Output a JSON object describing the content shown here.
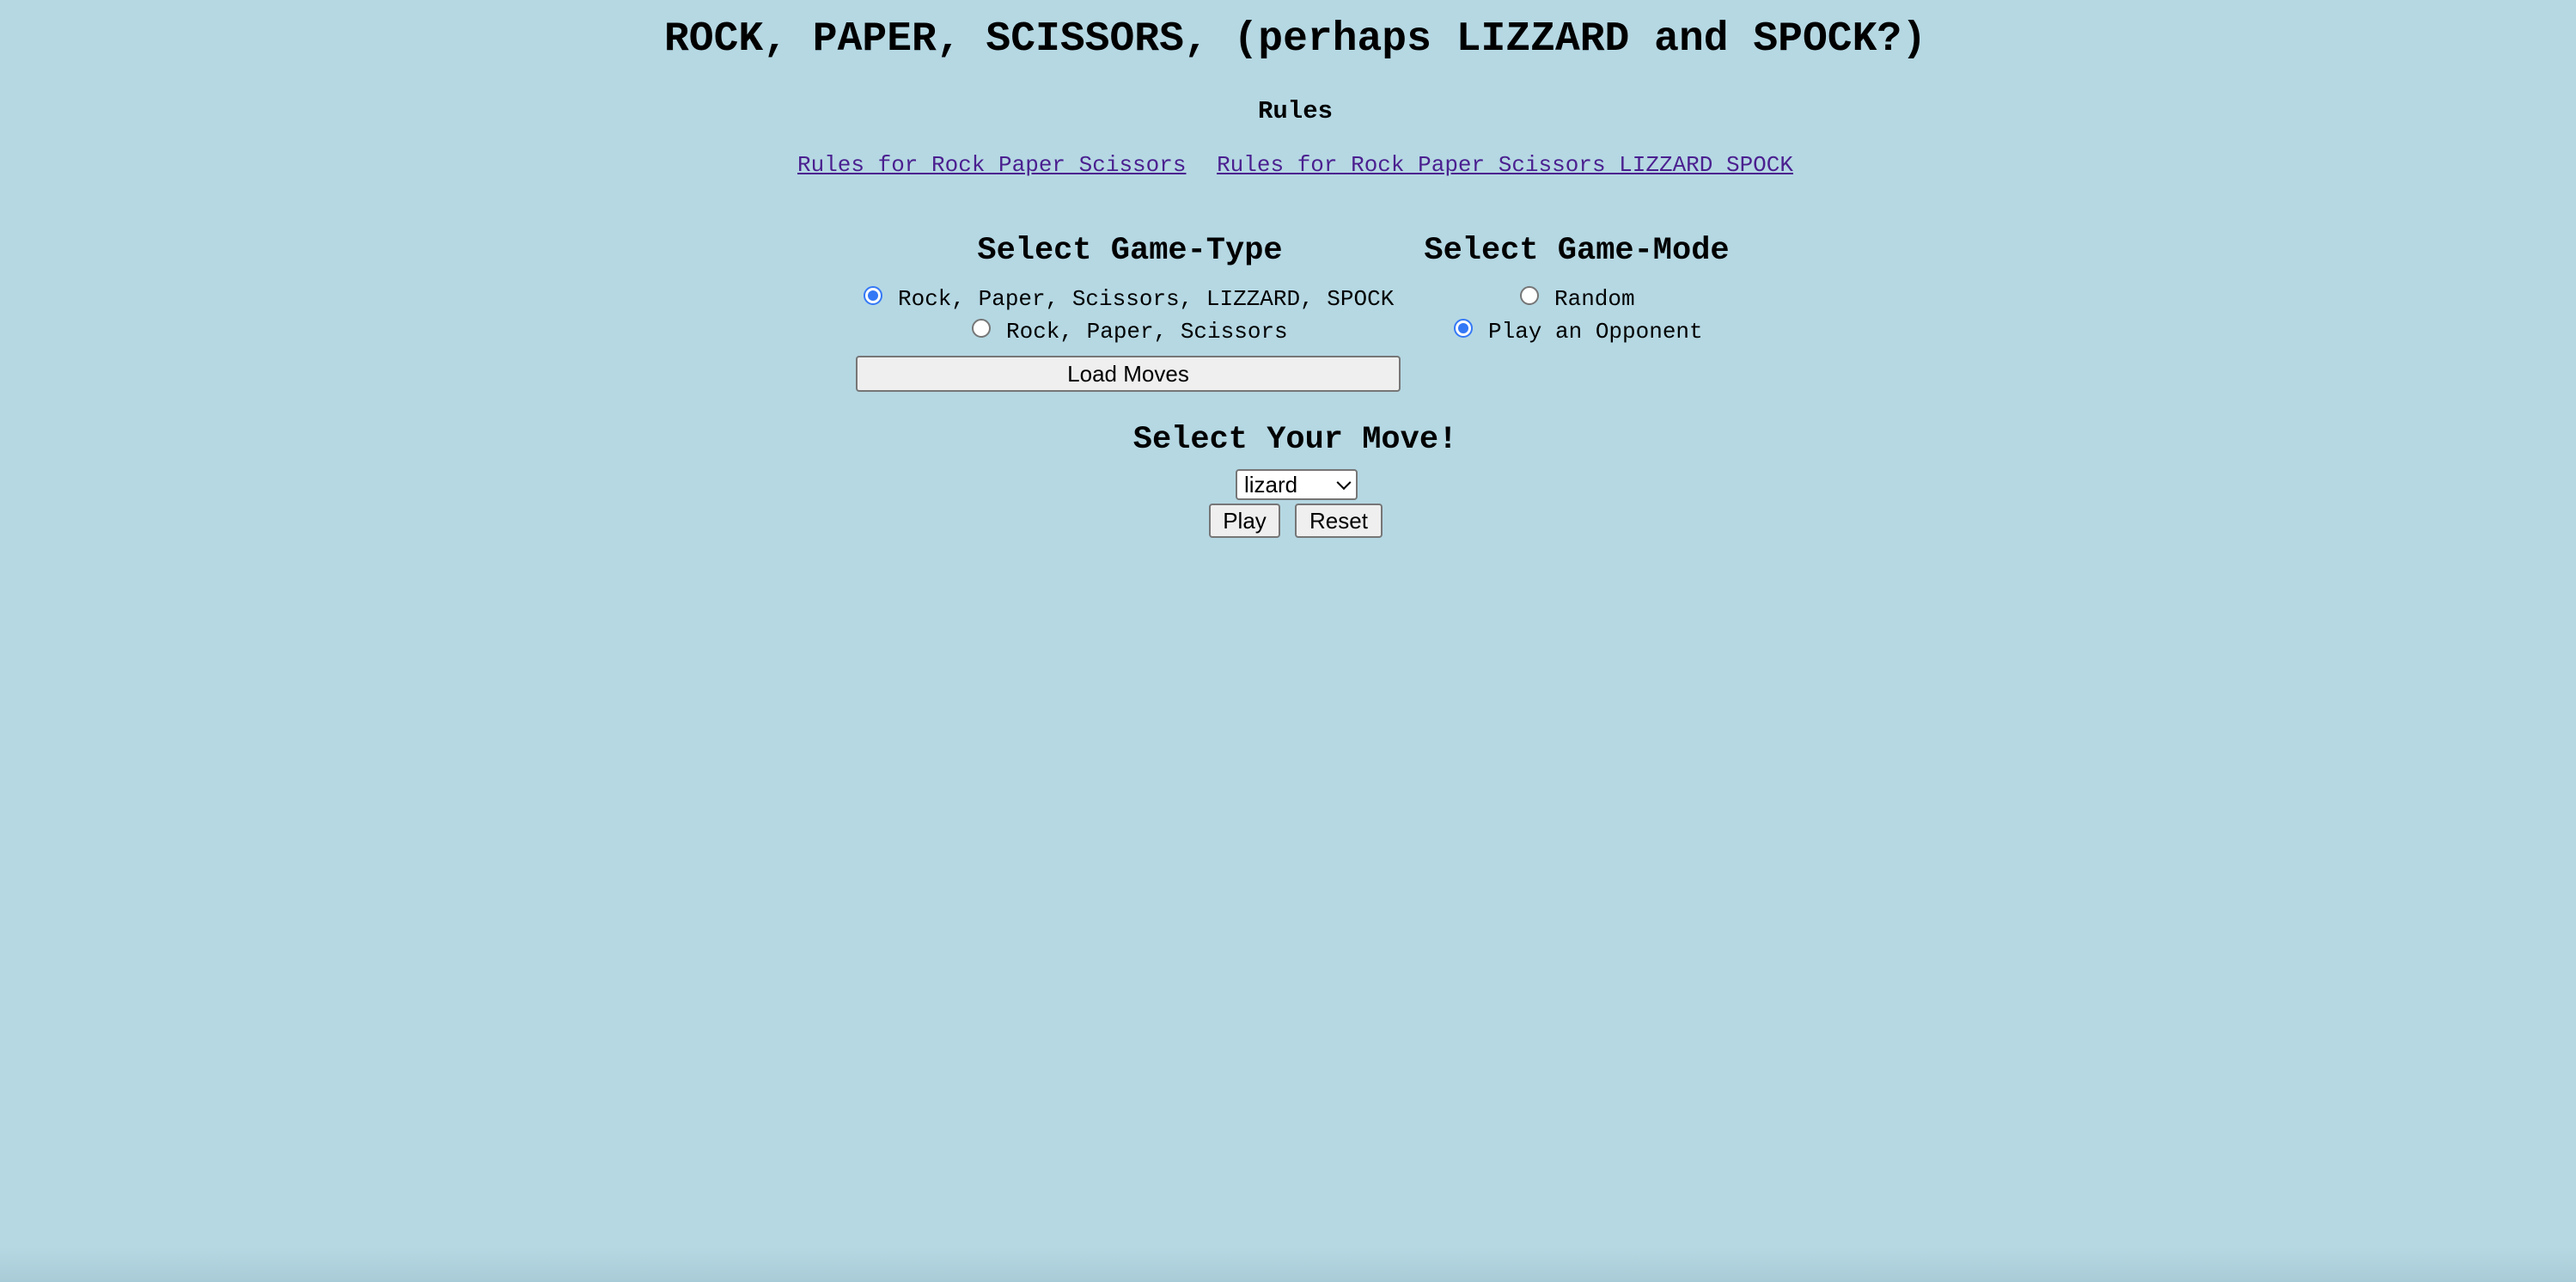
{
  "page": {
    "title": "ROCK, PAPER, SCISSORS, (perhaps LIZZARD and SPOCK?)",
    "background_color": "#b5d8e3"
  },
  "rules": {
    "heading": "Rules",
    "links": [
      {
        "label": "Rules for Rock Paper Scissors"
      },
      {
        "label": "Rules for Rock Paper Scissors LIZZARD SPOCK"
      }
    ],
    "link_color": "#4b1f8f"
  },
  "game_type": {
    "heading": "Select Game-Type",
    "options": [
      {
        "label": "Rock, Paper, Scissors, LIZZARD, SPOCK",
        "checked": true
      },
      {
        "label": "Rock, Paper, Scissors",
        "checked": false
      }
    ],
    "load_button_label": "Load Moves"
  },
  "game_mode": {
    "heading": "Select Game-Mode",
    "options": [
      {
        "label": "Random",
        "checked": false
      },
      {
        "label": "Play an Opponent",
        "checked": true
      }
    ]
  },
  "move": {
    "heading": "Select Your Move!",
    "selected": "lizard",
    "play_label": "Play",
    "reset_label": "Reset"
  },
  "colors": {
    "radio_checked": "#3478f6"
  }
}
